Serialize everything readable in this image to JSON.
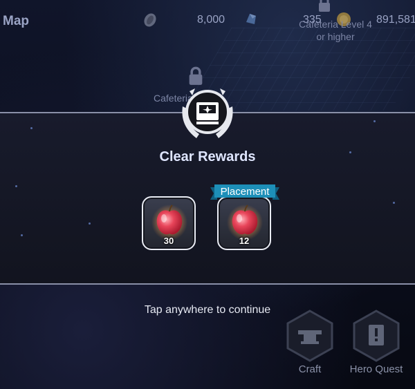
{
  "topbar": {
    "map_label": "Map",
    "resource_1": "8,000",
    "resource_2": "335",
    "resource_3": "891,581",
    "locked_caption_line1": "Cafeteria Level 4",
    "locked_caption_line2": "or higher"
  },
  "background": {
    "building_label": "Cafeteria 2"
  },
  "dialog": {
    "title": "Clear Rewards",
    "rewards": [
      {
        "icon": "apple-icon",
        "quantity": "30",
        "tag": ""
      },
      {
        "icon": "apple-icon",
        "quantity": "12",
        "tag": "Placement"
      }
    ],
    "continue_hint": "Tap anywhere to continue"
  },
  "menu": {
    "craft_label": "Craft",
    "hero_quest_label": "Hero Quest"
  },
  "colors": {
    "accent_ribbon": "#1d8fb8",
    "apple_red": "#e8455a",
    "panel_border": "#8a90a8"
  }
}
